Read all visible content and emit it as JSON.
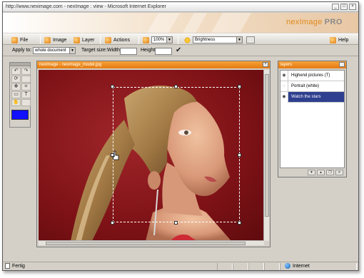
{
  "window": {
    "title": "http://www.neximage.com - nexImage : view - Microsoft Internet Explorer",
    "controls": [
      "_",
      "□",
      "×"
    ]
  },
  "branding": {
    "logo_main": "nexImage",
    "logo_suffix": "PRO"
  },
  "menubar": {
    "items": [
      "File",
      "Image",
      "Layer",
      "Actions"
    ],
    "zoom": "100%",
    "adjustment": "Brightness",
    "help": "Help"
  },
  "options": {
    "apply_to_label": "Apply to:",
    "apply_to_value": "whole document",
    "target_size_label": "Target size:",
    "width_label": "Width",
    "height_label": "Height",
    "width_value": "",
    "height_value": ""
  },
  "toolbox": {
    "primary_color": "#1010ff"
  },
  "document": {
    "title": "nexImage - neximage_model.jpg"
  },
  "layers": {
    "title": "layers",
    "items": [
      {
        "name": "Highend pictures (T)",
        "active": false
      },
      {
        "name": "Portrait (white)",
        "active": false
      },
      {
        "name": "Watch the stars",
        "active": true
      }
    ]
  },
  "status": {
    "left": "Fertig",
    "zone": "Internet"
  }
}
